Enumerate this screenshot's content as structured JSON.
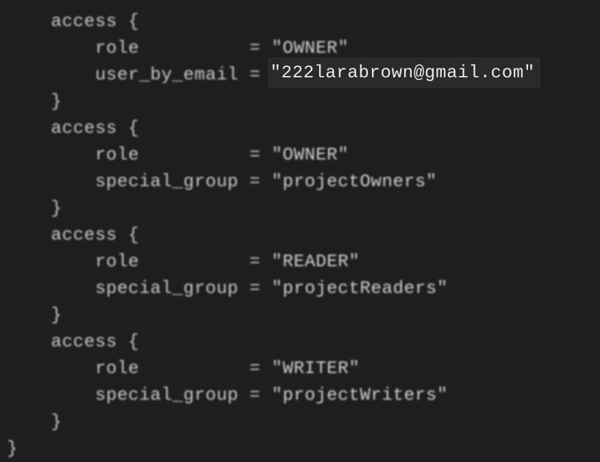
{
  "code": {
    "blocks": [
      {
        "header": "access {",
        "role_key": "role",
        "role_val": "\"OWNER\"",
        "attr_key": "user_by_email",
        "attr_val": "\"222larabrown@gmail.com\"",
        "highlighted": true,
        "closer": "}"
      },
      {
        "header": "access {",
        "role_key": "role",
        "role_val": "\"OWNER\"",
        "attr_key": "special_group",
        "attr_val": "\"projectOwners\"",
        "highlighted": false,
        "closer": "}"
      },
      {
        "header": "access {",
        "role_key": "role",
        "role_val": "\"READER\"",
        "attr_key": "special_group",
        "attr_val": "\"projectReaders\"",
        "highlighted": false,
        "closer": "}"
      },
      {
        "header": "access {",
        "role_key": "role",
        "role_val": "\"WRITER\"",
        "attr_key": "special_group",
        "attr_val": "\"projectWriters\"",
        "highlighted": false,
        "closer": "}"
      }
    ],
    "final_brace": "}",
    "role_pad": "          ",
    "attr_pad_user": " ",
    "attr_pad_group": " ",
    "eq": "="
  }
}
